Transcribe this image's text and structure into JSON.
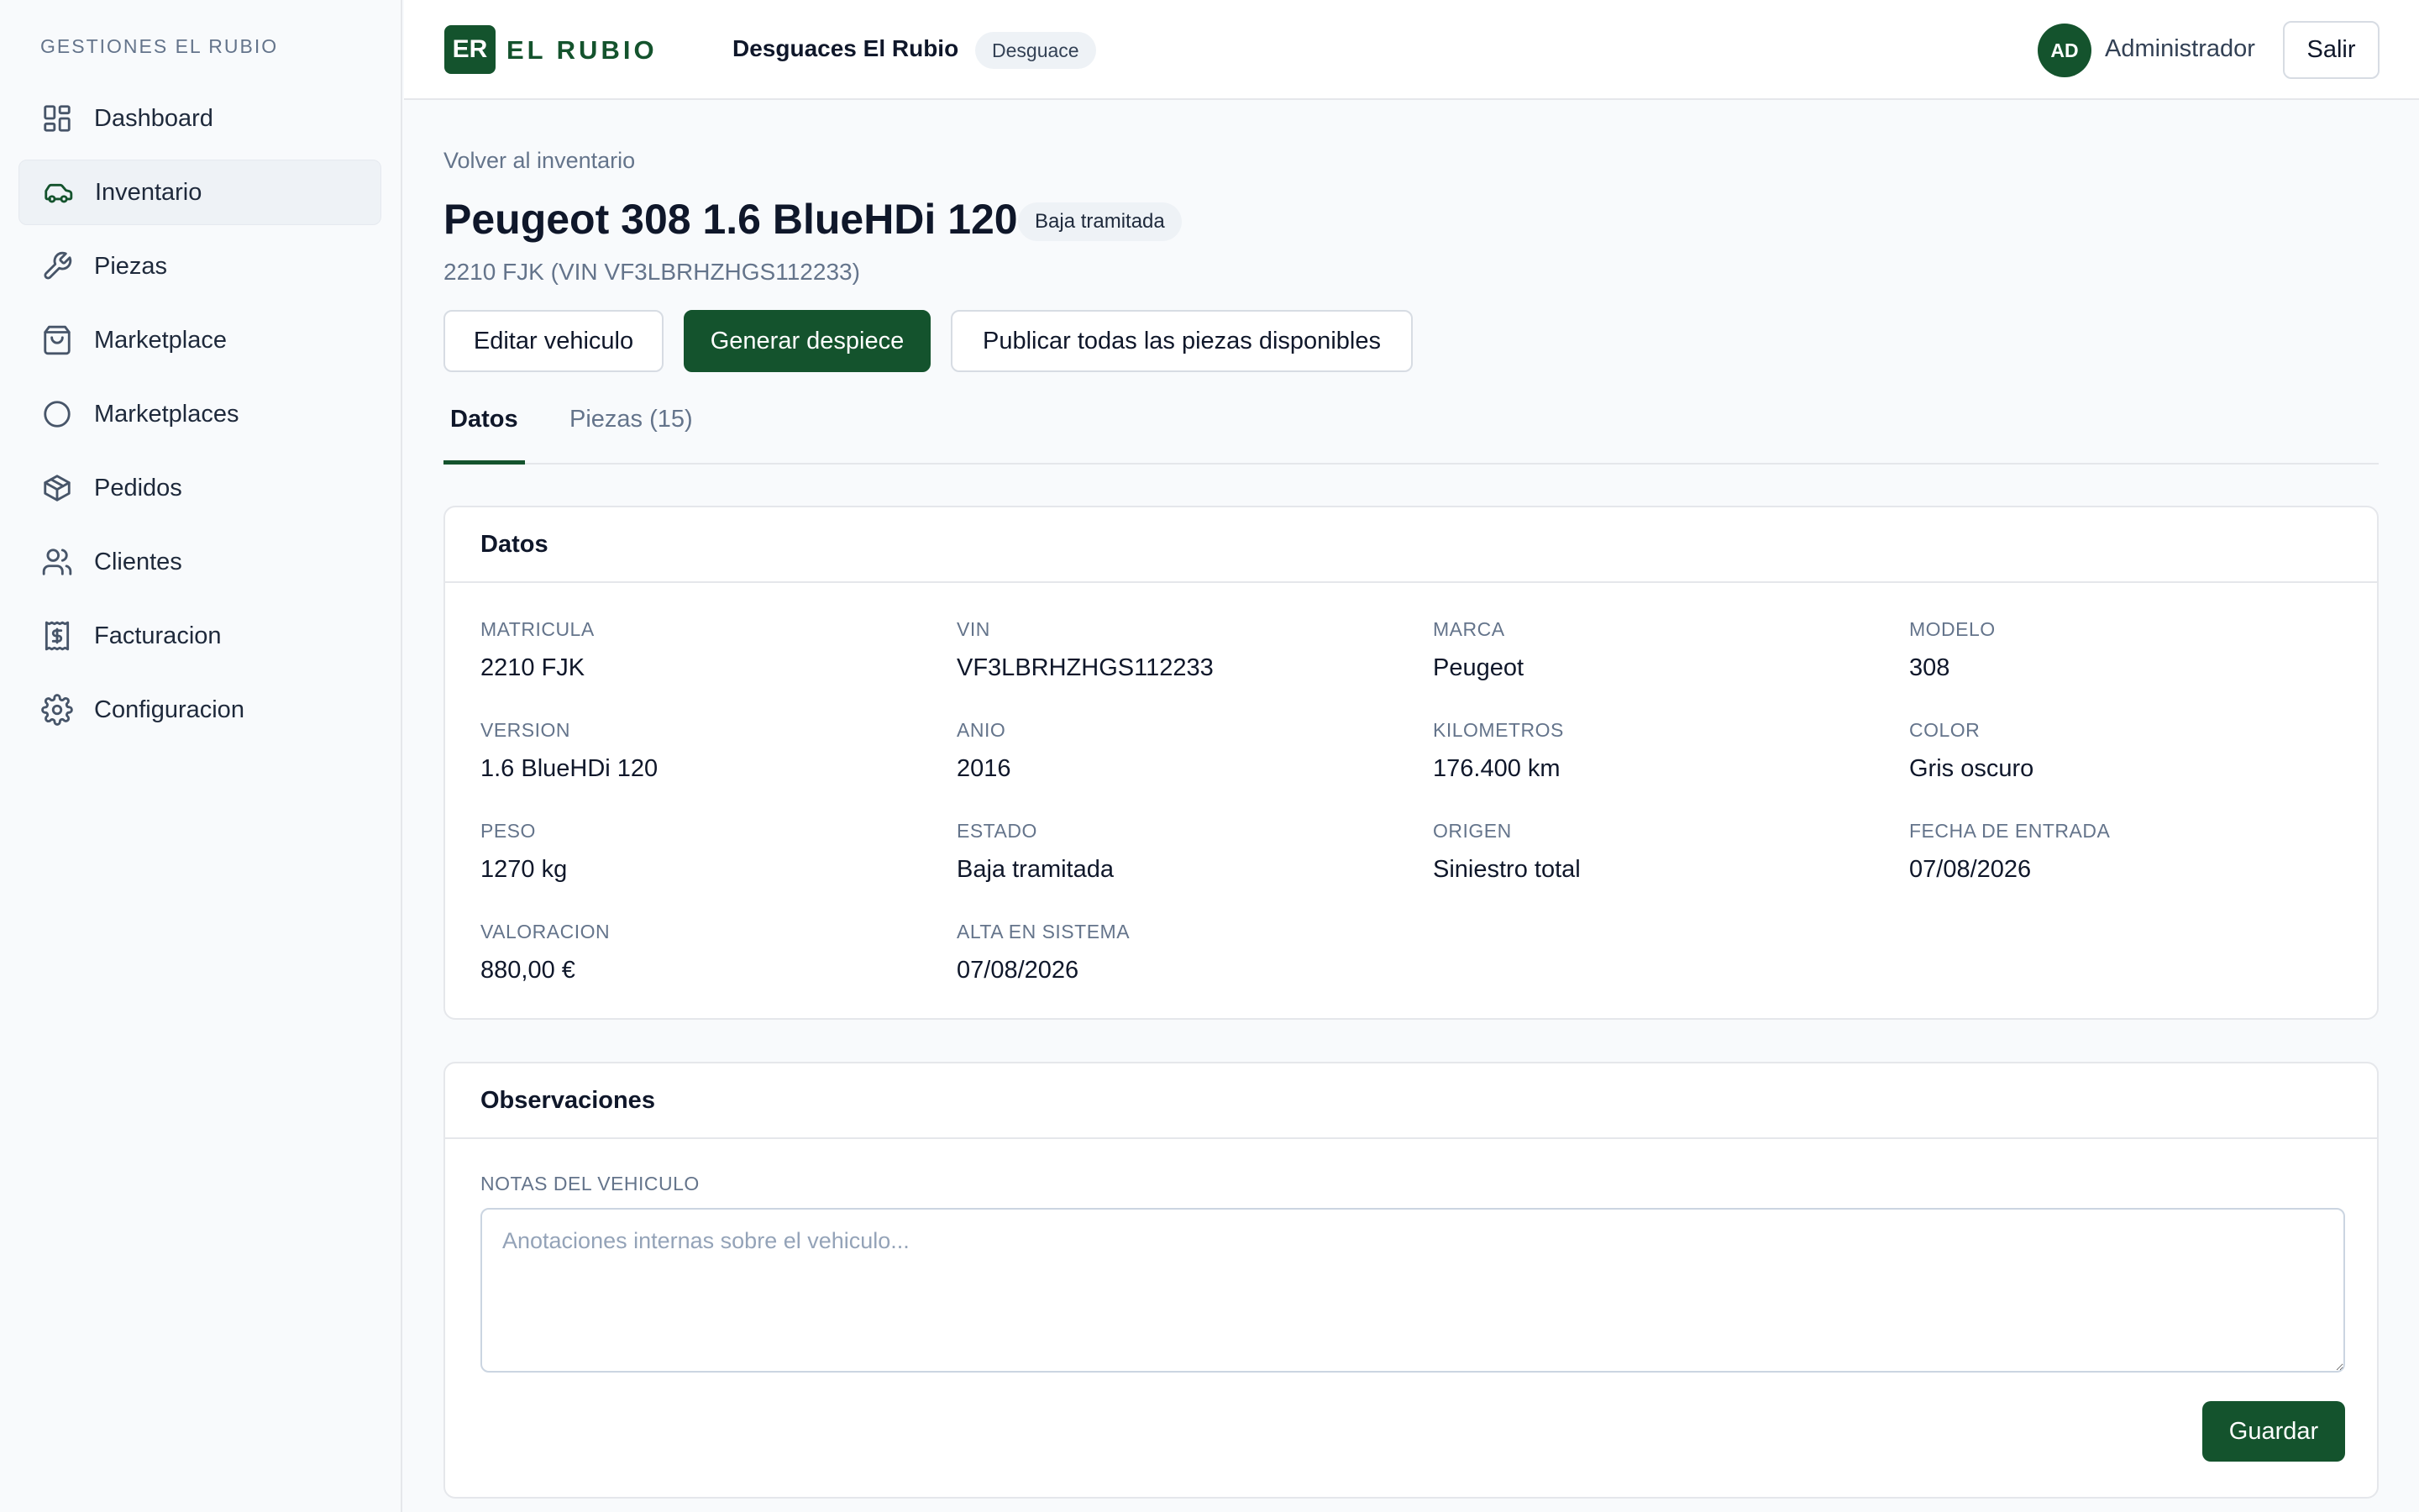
{
  "sidebar": {
    "brand": "GESTIONES EL RUBIO",
    "items": [
      {
        "label": "Dashboard",
        "icon": "dashboard-icon"
      },
      {
        "label": "Inventario",
        "icon": "car-icon"
      },
      {
        "label": "Piezas",
        "icon": "wrench-icon"
      },
      {
        "label": "Marketplace",
        "icon": "shopping-bag-icon"
      },
      {
        "label": "Marketplaces",
        "icon": "circle-icon"
      },
      {
        "label": "Pedidos",
        "icon": "package-icon"
      },
      {
        "label": "Clientes",
        "icon": "users-icon"
      },
      {
        "label": "Facturacion",
        "icon": "receipt-icon"
      },
      {
        "label": "Configuracion",
        "icon": "gear-icon"
      }
    ]
  },
  "header": {
    "logo_initials": "ER",
    "logo_text": "EL RUBIO",
    "company": "Desguaces El Rubio",
    "company_type": "Desguace",
    "avatar_initials": "AD",
    "user": "Administrador",
    "logout_label": "Salir"
  },
  "page": {
    "back_label": "Volver al inventario",
    "title": "Peugeot 308 1.6 BlueHDi 120",
    "status": "Baja tramitada",
    "subtitle": "2210 FJK (VIN VF3LBRHZHGS112233)",
    "actions": {
      "edit": "Editar vehiculo",
      "generate": "Generar despiece",
      "publish": "Publicar todas las piezas disponibles"
    },
    "tabs": [
      {
        "label": "Datos"
      },
      {
        "label": "Piezas (15)"
      }
    ]
  },
  "datos": {
    "title": "Datos",
    "fields": [
      {
        "label": "MATRICULA",
        "value": "2210 FJK"
      },
      {
        "label": "VIN",
        "value": "VF3LBRHZHGS112233"
      },
      {
        "label": "MARCA",
        "value": "Peugeot"
      },
      {
        "label": "MODELO",
        "value": "308"
      },
      {
        "label": "VERSION",
        "value": "1.6 BlueHDi 120"
      },
      {
        "label": "ANIO",
        "value": "2016"
      },
      {
        "label": "KILOMETROS",
        "value": "176.400 km"
      },
      {
        "label": "COLOR",
        "value": "Gris oscuro"
      },
      {
        "label": "PESO",
        "value": "1270 kg"
      },
      {
        "label": "ESTADO",
        "value": "Baja tramitada"
      },
      {
        "label": "ORIGEN",
        "value": "Siniestro total"
      },
      {
        "label": "FECHA DE ENTRADA",
        "value": "07/08/2026"
      },
      {
        "label": "VALORACION",
        "value": "880,00 €"
      },
      {
        "label": "ALTA EN SISTEMA",
        "value": "07/08/2026"
      }
    ]
  },
  "observaciones": {
    "title": "Observaciones",
    "notes_label": "NOTAS DEL VEHICULO",
    "notes_placeholder": "Anotaciones internas sobre el vehiculo...",
    "notes_value": "",
    "save_label": "Guardar"
  },
  "colors": {
    "accent": "#14532d",
    "background": "#f8fafc",
    "border": "#e5e7eb"
  }
}
